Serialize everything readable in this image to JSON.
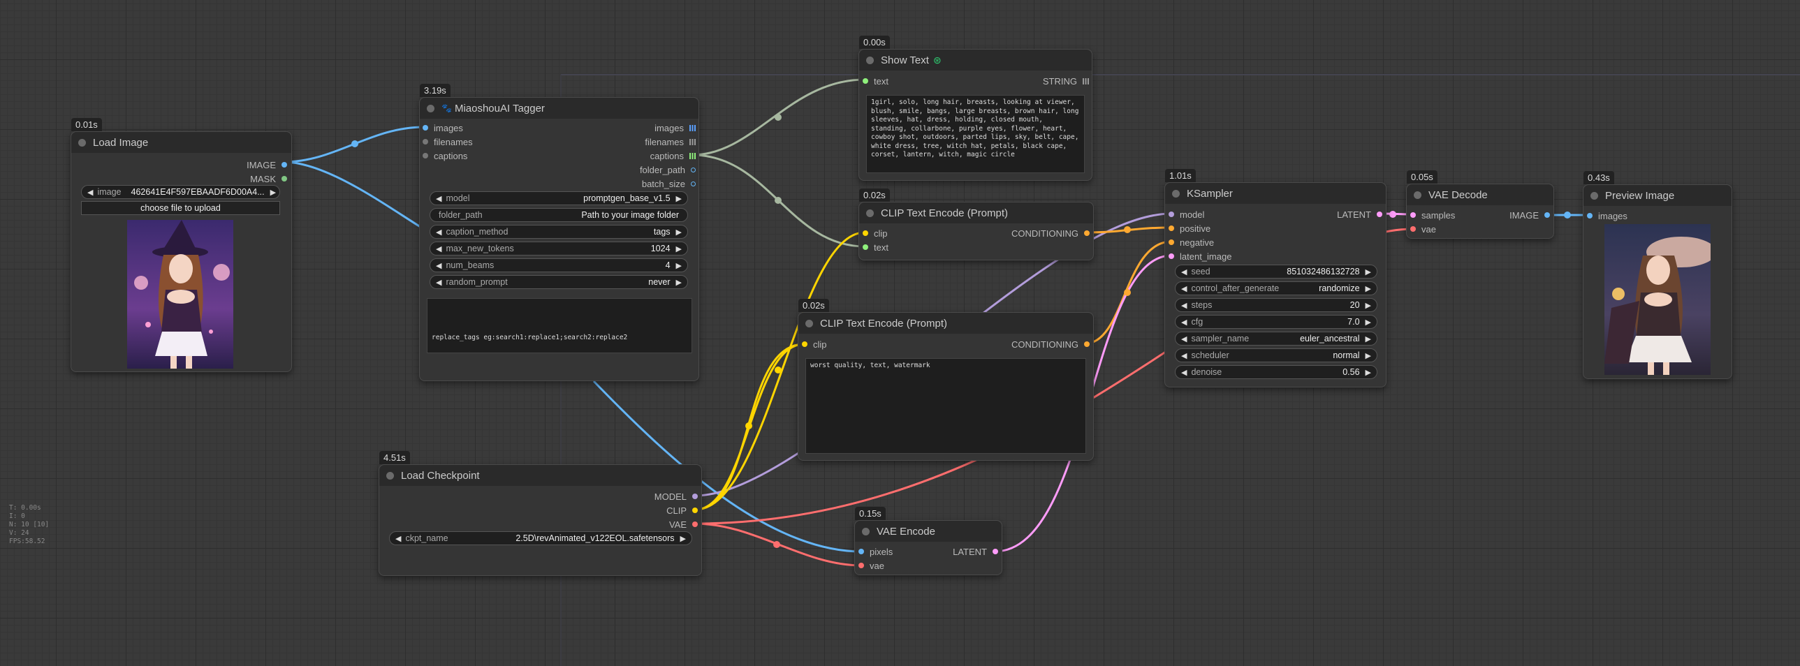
{
  "colors": {
    "image": "#64b5f6",
    "clip": "#ffd500",
    "conditioning": "#ffa931",
    "model": "#b39ddb",
    "vae": "#ff6e6e",
    "latent": "#ff9cf9",
    "string": "#7fbf7f",
    "mask": "#81c784",
    "captions_link": "#a7b8a0"
  },
  "nodes": {
    "load_image": {
      "timing": "0.01s",
      "title": "Load Image",
      "outputs": [
        "IMAGE",
        "MASK"
      ],
      "widget_label": "image",
      "widget_value": "462641E4F597EBAADF6D00A4...",
      "upload_label": "choose file to upload",
      "preview_icon": "anime-witch-girl-image"
    },
    "tagger": {
      "timing": "3.19s",
      "title": "MiaoshouAI Tagger",
      "inputs": [
        "images",
        "filenames",
        "captions"
      ],
      "outputs": [
        "images",
        "filenames",
        "captions",
        "folder_path",
        "batch_size"
      ],
      "widgets": [
        {
          "label": "model",
          "value": "promptgen_base_v1.5",
          "arrows": true
        },
        {
          "label": "folder_path",
          "value": "Path to your image folder",
          "arrows": false
        },
        {
          "label": "caption_method",
          "value": "tags",
          "arrows": true
        },
        {
          "label": "max_new_tokens",
          "value": "1024",
          "arrows": true
        },
        {
          "label": "num_beams",
          "value": "4",
          "arrows": true
        },
        {
          "label": "random_prompt",
          "value": "never",
          "arrows": true
        }
      ],
      "textbox": "replace_tags eg:search1:replace1;search2:replace2"
    },
    "show_text": {
      "timing": "0.00s",
      "title": "Show Text",
      "input": "text",
      "output": "STRING",
      "text": "1girl, solo, long hair, breasts, looking at viewer, blush, smile, bangs, large breasts, brown hair, long sleeves, hat, dress, holding, closed mouth, standing, collarbone, purple eyes, flower, heart, cowboy shot, outdoors, parted lips, sky, belt, cape, white dress, tree, witch hat, petals, black cape, corset, lantern, witch, magic circle"
    },
    "clip_pos": {
      "timing": "0.02s",
      "title": "CLIP Text Encode (Prompt)",
      "inputs": [
        "clip",
        "text"
      ],
      "output": "CONDITIONING"
    },
    "clip_neg": {
      "timing": "0.02s",
      "title": "CLIP Text Encode (Prompt)",
      "input": "clip",
      "output": "CONDITIONING",
      "text": "worst quality, text, watermark"
    },
    "ksampler": {
      "timing": "1.01s",
      "title": "KSampler",
      "inputs": [
        "model",
        "positive",
        "negative",
        "latent_image"
      ],
      "output": "LATENT",
      "widgets": [
        {
          "label": "seed",
          "value": "851032486132728"
        },
        {
          "label": "control_after_generate",
          "value": "randomize"
        },
        {
          "label": "steps",
          "value": "20"
        },
        {
          "label": "cfg",
          "value": "7.0"
        },
        {
          "label": "sampler_name",
          "value": "euler_ancestral"
        },
        {
          "label": "scheduler",
          "value": "normal"
        },
        {
          "label": "denoise",
          "value": "0.56"
        }
      ]
    },
    "vae_decode": {
      "timing": "0.05s",
      "title": "VAE Decode",
      "inputs": [
        "samples",
        "vae"
      ],
      "output": "IMAGE"
    },
    "preview": {
      "timing": "0.43s",
      "title": "Preview Image",
      "input": "images",
      "preview_icon": "anime-witch-girl-output-image"
    },
    "checkpoint": {
      "timing": "4.51s",
      "title": "Load Checkpoint",
      "outputs": [
        "MODEL",
        "CLIP",
        "VAE"
      ],
      "widget_label": "ckpt_name",
      "widget_value": "2.5D\\revAnimated_v122EOL.safetensors"
    },
    "vae_encode": {
      "timing": "0.15s",
      "title": "VAE Encode",
      "inputs": [
        "pixels",
        "vae"
      ],
      "output": "LATENT"
    }
  },
  "stats": [
    "T: 0.00s",
    "I: 0",
    "N: 10 [10]",
    "V: 24",
    "FPS:58.52"
  ]
}
